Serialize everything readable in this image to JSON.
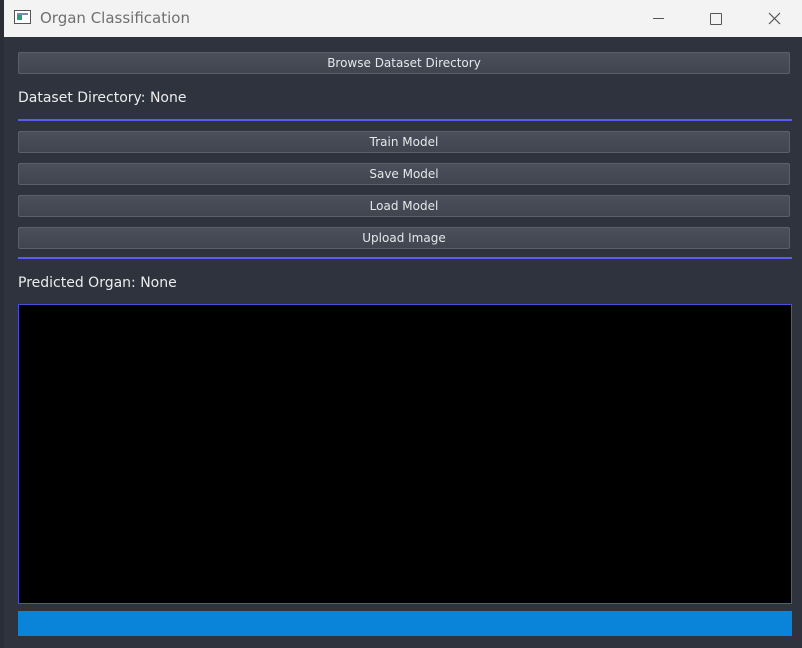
{
  "window": {
    "title": "Organ Classification",
    "icons": {
      "app": "app-window-icon",
      "minimize": "minimize-icon",
      "maximize": "maximize-icon",
      "close": "close-icon"
    }
  },
  "buttons": {
    "browse": "Browse Dataset Directory",
    "train": "Train Model",
    "save": "Save Model",
    "load": "Load Model",
    "upload": "Upload Image"
  },
  "labels": {
    "dataset_directory": "Dataset Directory: None",
    "predicted_organ": "Predicted Organ: None"
  },
  "progress": {
    "value_percent": 100
  },
  "colors": {
    "accent_separator": "#5b5cf0",
    "progress_fill": "#0a84d8",
    "image_border": "#4a4ed8"
  }
}
